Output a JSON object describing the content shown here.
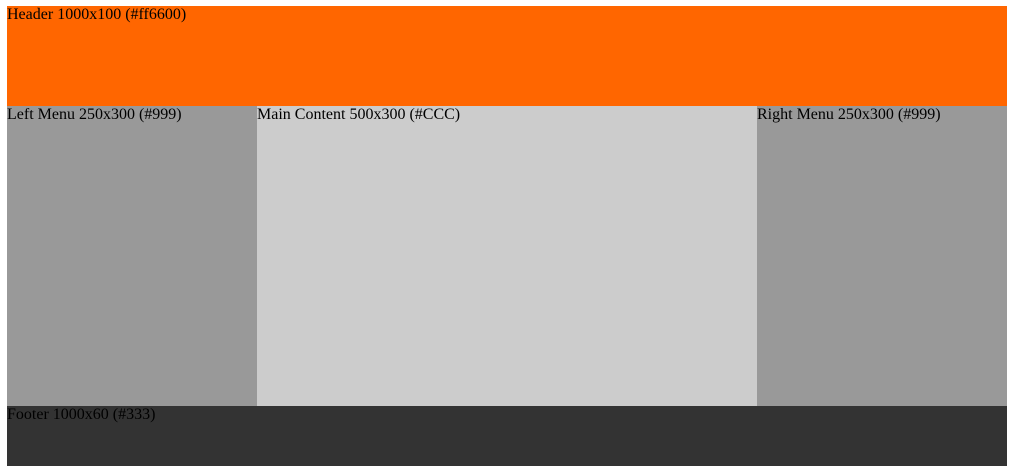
{
  "header": {
    "label": "Header 1000x100 (#ff6600)",
    "color": "#ff6600"
  },
  "left_menu": {
    "label": "Left Menu 250x300 (#999)",
    "color": "#999999"
  },
  "main_content": {
    "label": "Main Content 500x300 (#CCC)",
    "color": "#cccccc"
  },
  "right_menu": {
    "label": "Right Menu 250x300 (#999)",
    "color": "#999999"
  },
  "footer": {
    "label": "Footer 1000x60 (#333)",
    "color": "#333333"
  }
}
